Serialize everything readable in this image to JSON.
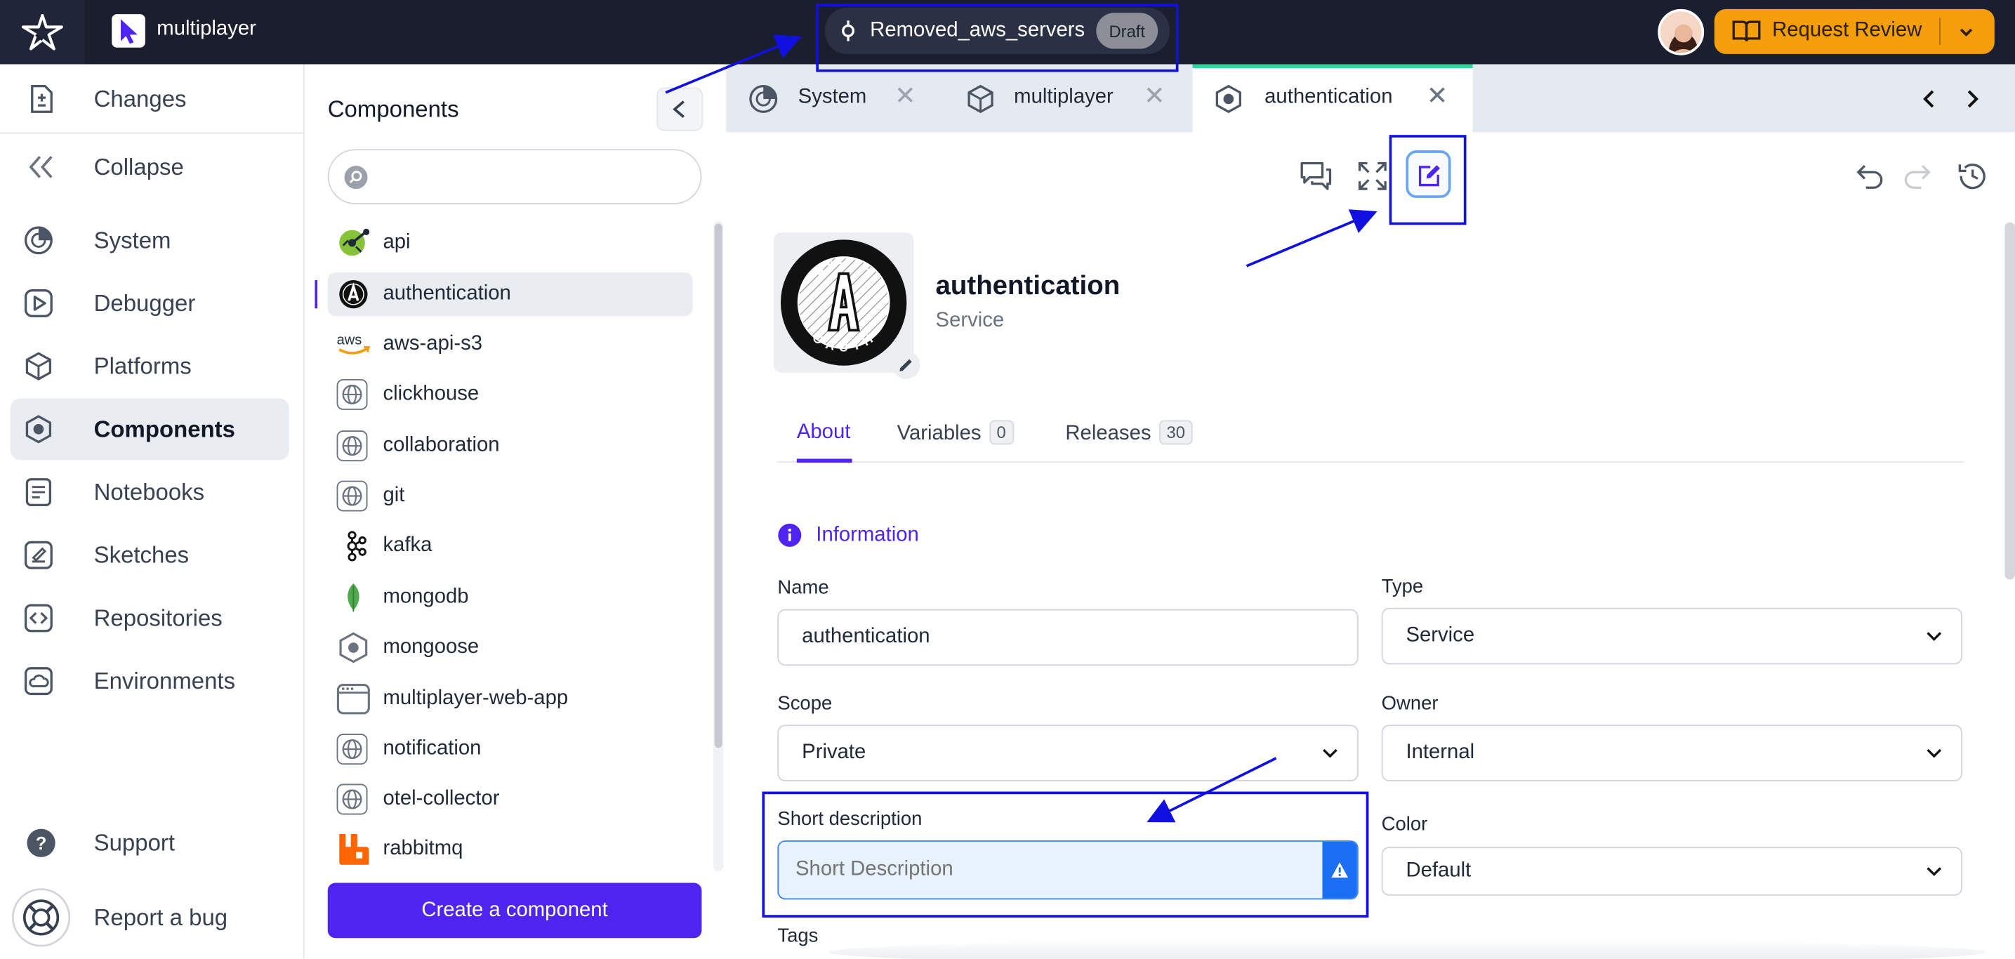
{
  "topbar": {
    "project_name": "multiplayer",
    "branch_name": "Removed_aws_servers",
    "branch_status": "Draft",
    "request_review_label": "Request Review"
  },
  "leftnav": {
    "changes": "Changes",
    "collapse": "Collapse",
    "items": [
      {
        "label": "System",
        "icon": "system-icon"
      },
      {
        "label": "Debugger",
        "icon": "debugger-icon"
      },
      {
        "label": "Platforms",
        "icon": "platforms-icon"
      },
      {
        "label": "Components",
        "icon": "components-icon"
      },
      {
        "label": "Notebooks",
        "icon": "notebooks-icon"
      },
      {
        "label": "Sketches",
        "icon": "sketches-icon"
      },
      {
        "label": "Repositories",
        "icon": "repositories-icon"
      },
      {
        "label": "Environments",
        "icon": "environments-icon"
      }
    ],
    "support": "Support",
    "report_bug": "Report a bug"
  },
  "components_panel": {
    "title": "Components",
    "search_placeholder": "",
    "items": [
      {
        "label": "api",
        "icon": "api-icon"
      },
      {
        "label": "authentication",
        "icon": "oauth-icon"
      },
      {
        "label": "aws-api-s3",
        "icon": "aws-icon"
      },
      {
        "label": "clickhouse",
        "icon": "globe-icon"
      },
      {
        "label": "collaboration",
        "icon": "globe-icon"
      },
      {
        "label": "git",
        "icon": "globe-icon"
      },
      {
        "label": "kafka",
        "icon": "kafka-icon"
      },
      {
        "label": "mongodb",
        "icon": "mongodb-leaf-icon"
      },
      {
        "label": "mongoose",
        "icon": "hexagon-icon"
      },
      {
        "label": "multiplayer-web-app",
        "icon": "browser-window-icon"
      },
      {
        "label": "notification",
        "icon": "globe-icon"
      },
      {
        "label": "otel-collector",
        "icon": "globe-icon"
      },
      {
        "label": "rabbitmq",
        "icon": "rabbitmq-icon"
      }
    ],
    "create_label": "Create a component"
  },
  "tabs": [
    {
      "label": "System"
    },
    {
      "label": "multiplayer"
    },
    {
      "label": "authentication"
    }
  ],
  "component": {
    "name": "authentication",
    "type_label": "Service",
    "logo_text_top": "OAUTH",
    "logo_text_bottom": "OAUTH"
  },
  "detail_tabs": {
    "about": "About",
    "variables": "Variables",
    "variables_count": "0",
    "releases": "Releases",
    "releases_count": "30"
  },
  "form": {
    "section_title": "Information",
    "name_label": "Name",
    "name_value": "authentication",
    "type_label": "Type",
    "type_value": "Service",
    "scope_label": "Scope",
    "scope_value": "Private",
    "owner_label": "Owner",
    "owner_value": "Internal",
    "short_desc_label": "Short description",
    "short_desc_placeholder": "Short Description",
    "color_label": "Color",
    "color_value": "Default",
    "tags_label": "Tags"
  },
  "colors": {
    "brand": "#4f23f0",
    "accent_orange": "#f59e0b",
    "topbar_bg": "#1a1e2e",
    "annotation_blue": "#1010e0",
    "active_tab_indicator": "#34d399"
  }
}
